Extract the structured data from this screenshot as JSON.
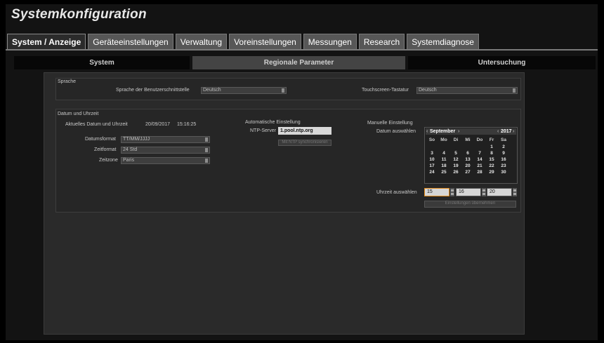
{
  "app": {
    "title": "Systemkonfiguration"
  },
  "tabs": [
    {
      "label": "System / Anzeige"
    },
    {
      "label": "Geräteeinstellungen"
    },
    {
      "label": "Verwaltung"
    },
    {
      "label": "Voreinstellungen"
    },
    {
      "label": "Messungen"
    },
    {
      "label": "Research"
    },
    {
      "label": "Systemdiagnose"
    }
  ],
  "subtabs": [
    {
      "label": "System"
    },
    {
      "label": "Regionale Parameter"
    },
    {
      "label": "Untersuchung"
    }
  ],
  "sprache": {
    "heading": "Sprache",
    "ui_language_label": "Sprache der Benutzerschnittstelle",
    "ui_language_value": "Deutsch",
    "touchscreen_label": "Touchscreen-Tastatur",
    "touchscreen_value": "Deutsch"
  },
  "datetime": {
    "heading": "Datum und Uhrzeit",
    "current_label": "Aktuelles Datum und Uhrzeit",
    "current_date": "20/09/2017",
    "current_time": "15:16:25",
    "dateformat_label": "Datumsformat",
    "dateformat_value": "TT/MM/JJJJ",
    "timeformat_label": "Zeitformat",
    "timeformat_value": "24 Std",
    "timezone_label": "Zeitzone",
    "timezone_value": "Paris"
  },
  "auto": {
    "heading": "Automatische Einstellung",
    "ntp_label": "NTP-Server",
    "ntp_value": "1.pool.ntp.org",
    "sync_button": "Mit NTP synchronisieren"
  },
  "manual": {
    "heading": "Manuelle Einstellung",
    "date_label": "Datum auswählen",
    "month": "September",
    "year": "2017",
    "weekdays": [
      "So",
      "Mo",
      "Di",
      "Mi",
      "Do",
      "Fr",
      "Sa"
    ],
    "weeks": [
      [
        "",
        "",
        "",
        "",
        "",
        "1",
        "2"
      ],
      [
        "3",
        "4",
        "5",
        "6",
        "7",
        "8",
        "9"
      ],
      [
        "10",
        "11",
        "12",
        "13",
        "14",
        "15",
        "16"
      ],
      [
        "17",
        "18",
        "19",
        "20",
        "21",
        "22",
        "23"
      ],
      [
        "24",
        "25",
        "26",
        "27",
        "28",
        "29",
        "30"
      ]
    ],
    "time_label": "Uhrzeit auswählen",
    "hour": "15",
    "minute": "16",
    "second": "20",
    "apply_button": "Einstellungen übernehmen"
  }
}
